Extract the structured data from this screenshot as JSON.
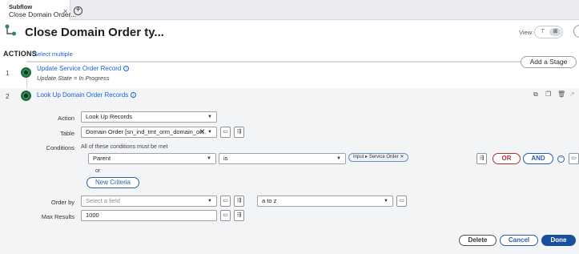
{
  "tab": {
    "type": "Subflow",
    "title": "Close Domain Order...",
    "close": "×",
    "add": "+"
  },
  "header": {
    "title": "Close Domain Order ty...",
    "view_label": "View:",
    "view_options": [
      "⊤",
      "⊞"
    ]
  },
  "actions": {
    "label": "ACTIONS",
    "select_multiple": "Select multiple",
    "add_stage": "Add a Stage"
  },
  "steps": [
    {
      "num": "1",
      "name": "Update Service Order Record",
      "subtitle": "Update State = In Progress"
    },
    {
      "num": "2",
      "name": "Look Up Domain Order Records"
    }
  ],
  "form": {
    "action_label": "Action",
    "action_value": "Look Up Records",
    "table_label": "Table",
    "table_value": "Domain Order [sn_ind_tmt_orm_domain_or...",
    "table_clear": "✕",
    "conditions_label": "Conditions",
    "conditions_hint": "All of these conditions must be met",
    "condition_field": "Parent",
    "condition_operator": "is",
    "condition_chip": "Input ▸ Service Order ✕",
    "or_btn": "OR",
    "and_btn": "AND",
    "or_text": "or",
    "new_criteria": "New Criteria",
    "order_by_label": "Order by",
    "order_by_placeholder": "Select a field",
    "order_direction": "a to z",
    "max_results_label": "Max Results",
    "max_results_value": "1000"
  },
  "footer": {
    "delete": "Delete",
    "cancel": "Cancel",
    "done": "Done"
  },
  "colors": {
    "accent": "#1a63d6",
    "primary_button": "#1a4fa0",
    "or_color": "#aa3333",
    "step_node": "#2e8b57",
    "panel_bg": "#f3f4f6"
  }
}
